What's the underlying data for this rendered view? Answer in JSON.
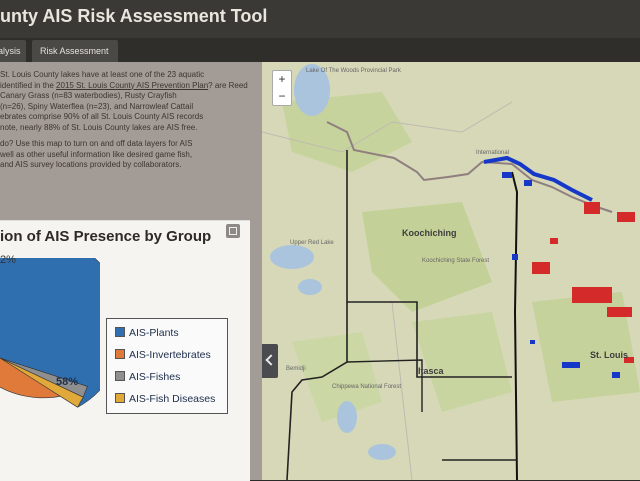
{
  "header": {
    "title": "unty AIS Risk Assessment Tool"
  },
  "tabs": [
    {
      "label": "alysis"
    },
    {
      "label": "Risk Assessment"
    }
  ],
  "intro": {
    "p1_part1": "St. Louis County lakes have at least one of the 23 aquatic",
    "p1_part2": "identified in the ",
    "p1_link": "2015 St. Louis County AIS Prevention Plan",
    "p1_part3": "? are Reed Canary Grass (n=83 waterbodies), Rusty Crayfish",
    "p1_part4": "(n=26), Spiny Waterflea (n=23), and Narrowleaf Cattail",
    "p1_part5": "ebrates comprise 90% of all St. Louis County AIS records",
    "p1_part6": "note, nearly 88% of St. Louis County lakes are AIS free.",
    "p2_part1": "do? Use this map to turn on and off data layers for AIS",
    "p2_part2": "well as other useful information like desired game fish,",
    "p2_part3": "and AIS survey locations provided by collaborators."
  },
  "chart_panel": {
    "title": "ion of AIS Presence by Group",
    "top_label": "2%",
    "main_label": "58%"
  },
  "chart_data": {
    "type": "pie",
    "title": "ion of AIS Presence by Group",
    "categories": [
      "AIS-Plants",
      "AIS-Invertebrates",
      "AIS-Fishes",
      "AIS-Fish Diseases"
    ],
    "values": [
      58,
      38,
      2,
      2
    ],
    "colors": [
      "#2f6fb0",
      "#e07a3a",
      "#8f8f8f",
      "#e0a93a"
    ],
    "legend": "right"
  },
  "legend": [
    {
      "label": "AIS-Plants",
      "color": "#2f6fb0"
    },
    {
      "label": "AIS-Invertebrates",
      "color": "#e07a3a"
    },
    {
      "label": "AIS-Fishes",
      "color": "#8f8f8f"
    },
    {
      "label": "AIS-Fish Diseases",
      "color": "#e0a93a"
    }
  ],
  "map": {
    "zoom_in": "+",
    "zoom_out": "−",
    "places": {
      "lake_woods": "Lake Of The Woods Provincial Park",
      "international": "International",
      "koochiching": "Koochiching",
      "koochiching_sf": "Koochiching State Forest",
      "upper_red": "Upper Red Lake",
      "itasca": "Itasca",
      "chippewa": "Chippewa National Forest",
      "bemidji": "Bemidji",
      "st_louis": "St. Louis"
    },
    "colors": {
      "ais_blue": "#1538c8",
      "ais_red": "#d42a2a",
      "county_line": "#222222",
      "water": "#a8c4dc",
      "forest": "#c8d69b"
    }
  }
}
